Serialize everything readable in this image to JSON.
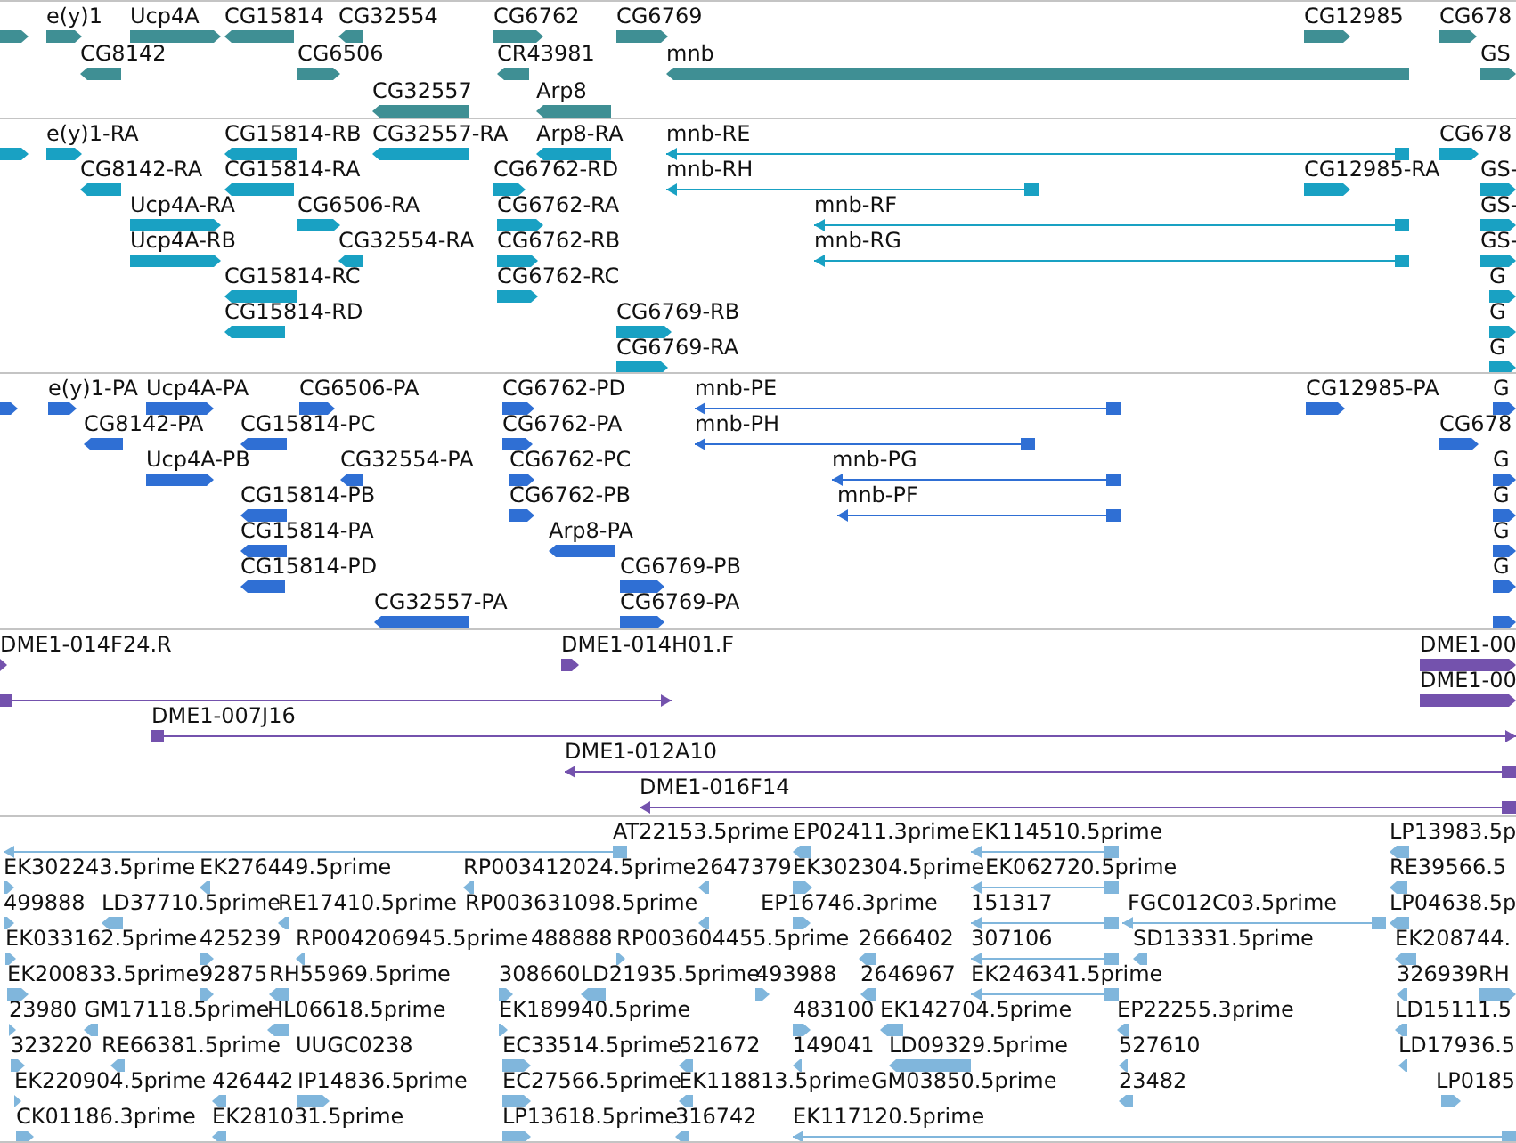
{
  "tracks": [
    {
      "kind": "gene",
      "features": [
        {
          "reverse": false
        },
        {
          "label": "e(y)1",
          "reverse": false
        },
        {
          "label": "Ucp4A",
          "reverse": false
        },
        {
          "label": "CG15814",
          "reverse": true
        },
        {
          "label": "CG32554",
          "reverse": true
        },
        {
          "label": "CG6762",
          "reverse": false
        },
        {
          "label": "CG6769",
          "reverse": false
        },
        {
          "label": "CG12985",
          "reverse": false
        },
        {
          "label": "CG678",
          "reverse": false
        },
        {
          "label": "CG8142",
          "reverse": true
        },
        {
          "label": "CG6506",
          "reverse": false
        },
        {
          "label": "CR43981",
          "reverse": true
        },
        {
          "label": "mnb",
          "reverse": true
        },
        {
          "label": "GS",
          "reverse": false
        },
        {
          "label": "CG32557",
          "reverse": true
        },
        {
          "label": "Arp8",
          "reverse": true
        }
      ]
    },
    {
      "kind": "transcript",
      "features": [
        {
          "reverse": false
        },
        {
          "label": "e(y)1-RA",
          "reverse": false
        },
        {
          "label": "CG15814-RB",
          "reverse": true
        },
        {
          "label": "CG32557-RA",
          "reverse": true
        },
        {
          "label": "Arp8-RA",
          "reverse": true
        },
        {
          "label": "mnb-RE",
          "reverse": true
        },
        {
          "label": "CG678",
          "reverse": false
        },
        {
          "label": "CG8142-RA",
          "reverse": true
        },
        {
          "label": "CG15814-RA",
          "reverse": true
        },
        {
          "label": "CG6762-RD",
          "reverse": false
        },
        {
          "label": "mnb-RH",
          "reverse": true
        },
        {
          "label": "CG12985-RA",
          "reverse": false
        },
        {
          "label": "GS-",
          "reverse": false
        },
        {
          "label": "Ucp4A-RA",
          "reverse": false
        },
        {
          "label": "CG6506-RA",
          "reverse": false
        },
        {
          "label": "CG6762-RA",
          "reverse": false
        },
        {
          "label": "mnb-RF",
          "reverse": true
        },
        {
          "label": "GS-",
          "reverse": false
        },
        {
          "label": "Ucp4A-RB",
          "reverse": false
        },
        {
          "label": "CG32554-RA",
          "reverse": true
        },
        {
          "label": "CG6762-RB",
          "reverse": false
        },
        {
          "label": "mnb-RG",
          "reverse": true
        },
        {
          "label": "GS-",
          "reverse": false
        },
        {
          "label": "CG15814-RC",
          "reverse": true
        },
        {
          "label": "CG6762-RC",
          "reverse": false
        },
        {
          "label": "G",
          "reverse": false
        },
        {
          "label": "CG15814-RD",
          "reverse": true
        },
        {
          "label": "CG6769-RB",
          "reverse": false
        },
        {
          "label": "G",
          "reverse": false
        },
        {
          "label": "CG6769-RA",
          "reverse": false
        },
        {
          "label": "G",
          "reverse": false
        }
      ]
    },
    {
      "kind": "protein",
      "features": [
        {
          "reverse": false
        },
        {
          "label": "e(y)1-PA",
          "reverse": false
        },
        {
          "label": "Ucp4A-PA",
          "reverse": false
        },
        {
          "label": "CG6506-PA",
          "reverse": false
        },
        {
          "label": "CG6762-PD",
          "reverse": false
        },
        {
          "label": "mnb-PE",
          "reverse": true
        },
        {
          "label": "CG12985-PA",
          "reverse": false
        },
        {
          "label": "G",
          "reverse": false
        },
        {
          "label": "CG8142-PA",
          "reverse": true
        },
        {
          "label": "CG15814-PC",
          "reverse": true
        },
        {
          "label": "CG6762-PA",
          "reverse": false
        },
        {
          "label": "mnb-PH",
          "reverse": true
        },
        {
          "label": "CG678",
          "reverse": false
        },
        {
          "label": "Ucp4A-PB",
          "reverse": false
        },
        {
          "label": "CG32554-PA",
          "reverse": true
        },
        {
          "label": "CG6762-PC",
          "reverse": false
        },
        {
          "label": "mnb-PG",
          "reverse": true
        },
        {
          "label": "G",
          "reverse": false
        },
        {
          "label": "CG15814-PB",
          "reverse": true
        },
        {
          "label": "CG6762-PB",
          "reverse": false
        },
        {
          "label": "mnb-PF",
          "reverse": true
        },
        {
          "label": "G",
          "reverse": false
        },
        {
          "label": "CG15814-PA",
          "reverse": true
        },
        {
          "label": "Arp8-PA",
          "reverse": true
        },
        {
          "label": "G",
          "reverse": false
        },
        {
          "label": "CG15814-PD",
          "reverse": true
        },
        {
          "label": "CG6769-PB",
          "reverse": false
        },
        {
          "label": "G",
          "reverse": false
        },
        {
          "label": "CG32557-PA",
          "reverse": true
        },
        {
          "label": "CG6769-PA",
          "reverse": false
        },
        {
          "reverse": false
        }
      ]
    },
    {
      "kind": "clone",
      "features": [
        {
          "label": "DME1-014F24.R",
          "reverse": false
        },
        {
          "label": "DME1-014H01.F",
          "reverse": false
        },
        {
          "label": "DME1-00",
          "reverse": false
        },
        {
          "reverse": false
        },
        {
          "label": "DME1-00",
          "reverse": false
        },
        {
          "label": "DME1-007J16",
          "reverse": false
        },
        {
          "label": "DME1-012A10",
          "reverse": true
        },
        {
          "label": "DME1-016F14",
          "reverse": true
        }
      ]
    },
    {
      "kind": "est",
      "features": [
        {
          "label": "AT22153.5prime",
          "reverse": true
        },
        {
          "label": "EP02411.3prime",
          "reverse": true
        },
        {
          "label": "EK114510.5prime",
          "reverse": true
        },
        {
          "label": "LP13983.5p",
          "reverse": true
        },
        {
          "label": "EK302243.5prime",
          "reverse": false
        },
        {
          "label": "EK276449.5prime",
          "reverse": true
        },
        {
          "label": "RP003412024.5prime",
          "reverse": true
        },
        {
          "label": "2647379",
          "reverse": true
        },
        {
          "label": "EK302304.5prime",
          "reverse": false
        },
        {
          "label": "EK062720.5prime",
          "reverse": true
        },
        {
          "label": "RE39566.5",
          "reverse": true
        },
        {
          "label": "499888",
          "reverse": false
        },
        {
          "label": "LD37710.5prime",
          "reverse": true
        },
        {
          "label": "RE17410.5prime",
          "reverse": true
        },
        {
          "label": "RP003631098.5prime",
          "reverse": true
        },
        {
          "label": "EP16746.3prime",
          "reverse": false
        },
        {
          "label": "151317",
          "reverse": true
        },
        {
          "label": "FGC012C03.5prime",
          "reverse": true
        },
        {
          "label": "LP04638.5p",
          "reverse": true
        },
        {
          "label": "EK033162.5prime",
          "reverse": false
        },
        {
          "label": "425239",
          "reverse": false
        },
        {
          "label": "RP004206945.5prime",
          "reverse": true
        },
        {
          "label": "488888"
        },
        {
          "label": "RP003604455.5prime",
          "reverse": false
        },
        {
          "label": "2666402",
          "reverse": true
        },
        {
          "label": "307106",
          "reverse": true
        },
        {
          "label": "SD13331.5prime",
          "reverse": true
        },
        {
          "label": "EK208744.",
          "reverse": true
        },
        {
          "label": "EK200833.5prime",
          "reverse": false
        },
        {
          "label": "92875",
          "reverse": false
        },
        {
          "label": "RH55969.5prime",
          "reverse": true
        },
        {
          "label": "308660",
          "reverse": false
        },
        {
          "label": "LD21935.5prime",
          "reverse": true
        },
        {
          "label": "493988",
          "reverse": false
        },
        {
          "label": "2646967",
          "reverse": true
        },
        {
          "label": "EK246341.5prime",
          "reverse": true
        },
        {
          "label": "326939",
          "reverse": true
        },
        {
          "label": "RH",
          "reverse": false
        },
        {
          "label": "23980",
          "reverse": false
        },
        {
          "label": "GM17118.5prime",
          "reverse": true
        },
        {
          "label": "HL06618.5prime",
          "reverse": true
        },
        {
          "label": "EK189940.5prime",
          "reverse": false
        },
        {
          "label": "483100",
          "reverse": false
        },
        {
          "label": "EK142704.5prime",
          "reverse": true
        },
        {
          "label": "EP22255.3prime",
          "reverse": true
        },
        {
          "label": "LD15111.5",
          "reverse": true
        },
        {
          "label": "323220",
          "reverse": false
        },
        {
          "label": "RE66381.5prime",
          "reverse": true
        },
        {
          "label": "UUGC0238"
        },
        {
          "label": "EC33514.5prime",
          "reverse": false
        },
        {
          "label": "521672",
          "reverse": true
        },
        {
          "label": "149041",
          "reverse": true
        },
        {
          "label": "LD09329.5prime",
          "reverse": true
        },
        {
          "label": "527610",
          "reverse": true
        },
        {
          "label": "LD17936.5",
          "reverse": true
        },
        {
          "label": "EK220904.5prime",
          "reverse": false
        },
        {
          "label": "426442",
          "reverse": true
        },
        {
          "label": "IP14836.5prime",
          "reverse": false
        },
        {
          "label": "EC27566.5prime",
          "reverse": false
        },
        {
          "label": "EK118813.5prime",
          "reverse": true
        },
        {
          "label": "GM03850.5prime"
        },
        {
          "label": "23482",
          "reverse": true
        },
        {
          "label": "LP0185",
          "reverse": false
        },
        {
          "label": "CK01186.3prime",
          "reverse": false
        },
        {
          "label": "EK281031.5prime",
          "reverse": true
        },
        {
          "label": "LP13618.5prime",
          "reverse": false
        },
        {
          "label": "316742",
          "reverse": true
        },
        {
          "label": "EK117120.5prime",
          "reverse": true
        }
      ]
    }
  ]
}
